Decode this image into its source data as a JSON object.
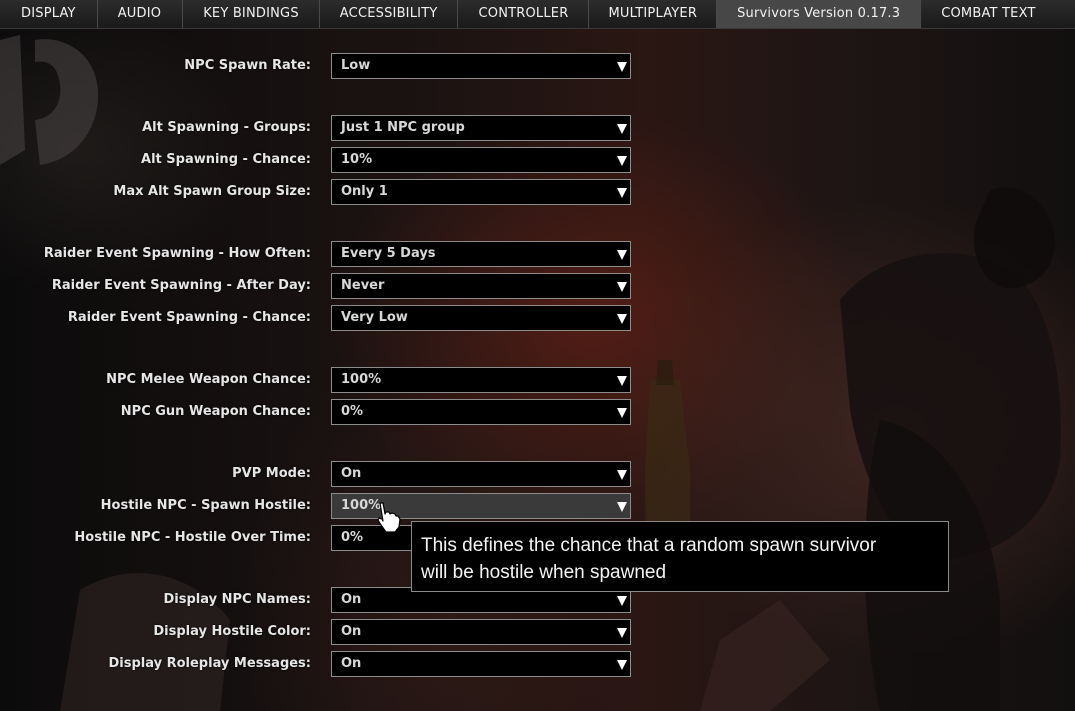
{
  "tabs": [
    {
      "label": "DISPLAY",
      "active": false
    },
    {
      "label": "AUDIO",
      "active": false
    },
    {
      "label": "KEY BINDINGS",
      "active": false
    },
    {
      "label": "ACCESSIBILITY",
      "active": false
    },
    {
      "label": "CONTROLLER",
      "active": false
    },
    {
      "label": "MULTIPLAYER",
      "active": false
    },
    {
      "label": "Survivors Version 0.17.3",
      "active": true
    },
    {
      "label": "COMBAT TEXT",
      "active": false
    }
  ],
  "settings": [
    {
      "label": "NPC Spawn Rate:",
      "value": "Low"
    },
    {
      "label": "Alt Spawning - Groups:",
      "value": "Just 1 NPC group"
    },
    {
      "label": "Alt Spawning - Chance:",
      "value": "10%"
    },
    {
      "label": "Max Alt Spawn Group Size:",
      "value": "Only 1"
    },
    {
      "label": "Raider Event Spawning - How Often:",
      "value": "Every 5 Days"
    },
    {
      "label": "Raider Event Spawning - After Day:",
      "value": "Never"
    },
    {
      "label": "Raider Event Spawning - Chance:",
      "value": "Very Low"
    },
    {
      "label": "NPC Melee Weapon Chance:",
      "value": "100%"
    },
    {
      "label": "NPC Gun Weapon Chance:",
      "value": "0%"
    },
    {
      "label": "PVP Mode:",
      "value": "On"
    },
    {
      "label": "Hostile NPC - Spawn Hostile:",
      "value": "100%"
    },
    {
      "label": "Hostile NPC - Hostile Over Time:",
      "value": "0%"
    },
    {
      "label": "Display NPC Names:",
      "value": "On"
    },
    {
      "label": "Display Hostile Color:",
      "value": "On"
    },
    {
      "label": "Display Roleplay Messages:",
      "value": "On"
    }
  ],
  "tooltip": {
    "line1": "This defines the chance that a random spawn survivor",
    "line2": "will be hostile when spawned"
  },
  "icons": {
    "dropdown": "chevron-down-icon",
    "cursor": "hand-pointer-icon"
  },
  "colors": {
    "tab_active": "#474747",
    "dropdown_bg": "#000000",
    "dropdown_hover_bg": "#3a3a3a",
    "tooltip_border": "#8a8a8a"
  }
}
